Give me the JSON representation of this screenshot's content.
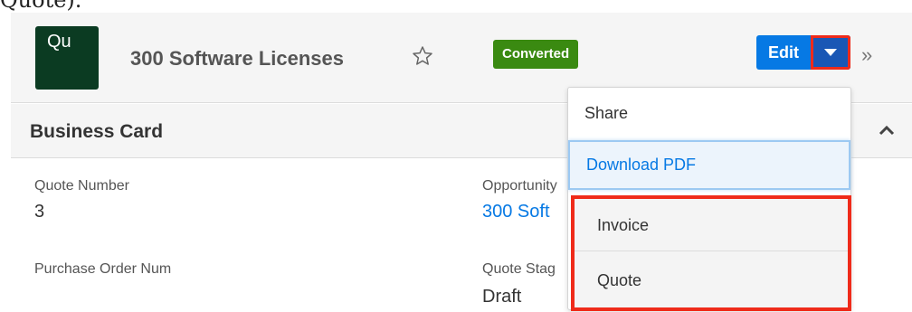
{
  "top_text": "Quote).",
  "header": {
    "module_abbr": "Qu",
    "record_title": "300 Software Licenses",
    "status": "Converted",
    "edit_label": "Edit",
    "more_glyph": "»"
  },
  "section": {
    "title": "Business Card"
  },
  "fields": {
    "quote_number_label": "Quote Number",
    "quote_number_value": "3",
    "opportunity_label": "Opportunity",
    "opportunity_value": "300 Soft",
    "po_label": "Purchase Order Num",
    "quote_stage_label": "Quote Stag",
    "quote_stage_value": "Draft"
  },
  "dropdown": {
    "items": [
      "Share",
      "Download PDF",
      "Invoice",
      "Quote"
    ]
  },
  "colors": {
    "module_badge": "#0b3b22",
    "status_badge": "#3a8a11",
    "primary": "#0679e4",
    "highlight": "#ef2b1a"
  },
  "icons": {
    "favorite": "star-icon",
    "dropdown": "caret-down-icon",
    "more": "double-chevron-right-icon",
    "collapse": "chevron-up-icon"
  }
}
